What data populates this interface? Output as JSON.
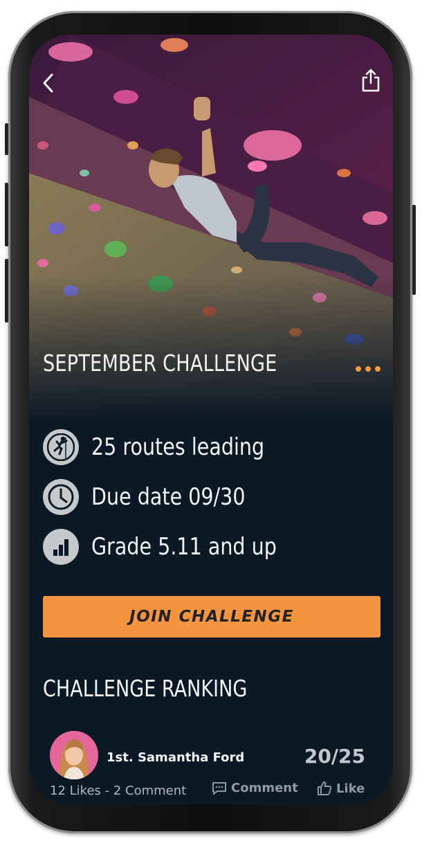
{
  "header": {
    "back_icon": "chevron-left-icon",
    "share_icon": "share-icon",
    "more_icon": "more-dots-icon"
  },
  "challenge": {
    "title": "SEPTEMBER CHALLENGE",
    "details": [
      {
        "icon": "climber-icon",
        "text": "25 routes leading"
      },
      {
        "icon": "clock-icon",
        "text": "Due date 09/30"
      },
      {
        "icon": "bar-chart-icon",
        "text": "Grade 5.11 and up"
      }
    ],
    "join_label": "JOIN CHALLENGE"
  },
  "ranking": {
    "title": "CHALLENGE RANKING",
    "entries": [
      {
        "name": "1st. Samantha Ford",
        "score": "20/25",
        "stats": "12 Likes - 2 Comment",
        "comment_label": "Comment",
        "like_label": "Like"
      }
    ]
  },
  "colors": {
    "accent": "#f5943f",
    "background": "#0b1826",
    "text": "#f4f4f4",
    "muted": "#8f98a3"
  }
}
